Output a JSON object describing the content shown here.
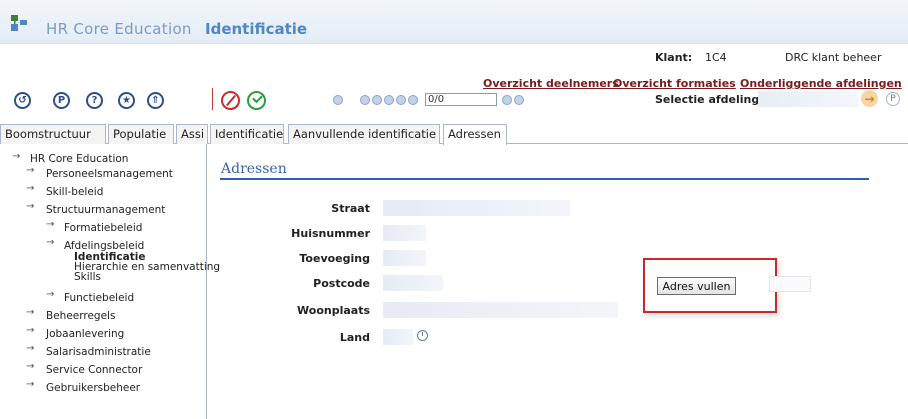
{
  "header": {
    "app_name": "HR Core Education",
    "page_name": "Identificatie"
  },
  "account": {
    "klant_label": "Klant:",
    "klant_value": "1C4",
    "role": "DRC klant beheer"
  },
  "links": {
    "overzicht_deelnemers": "Overzicht deelnemers",
    "overzicht_formaties": "Overzicht formaties",
    "onderliggende_afdelingen": "Onderliggende afdelingen"
  },
  "toolbar": {
    "icons": [
      "back-icon",
      "pin-icon",
      "help-icon",
      "favorite-icon",
      "upload-icon",
      "cancel-icon",
      "confirm-icon"
    ],
    "record_counter": "0/0"
  },
  "selectie": {
    "label": "Selectie afdeling",
    "value": "",
    "help": "P"
  },
  "tabs_left": [
    "Boomstructuur",
    "Populatie",
    "Assi"
  ],
  "tabs_main": [
    "Identificatie",
    "Aanvullende identificatie",
    "Adressen"
  ],
  "active_tab": "Adressen",
  "tree": {
    "root": "HR Core Education",
    "items": [
      "Personeelsmanagement",
      "Skill-beleid",
      "Structuurmanagement",
      "Formatiebeleid",
      "Afdelingsbeleid",
      "Identificatie",
      "Hierarchie en samenvatting",
      "Skills",
      "Functiebeleid",
      "Beheerregels",
      "Jobaanlevering",
      "Salarisadministratie",
      "Service Connector",
      "Gebruikersbeheer"
    ]
  },
  "section": {
    "title": "Adressen"
  },
  "form": {
    "fields": [
      {
        "label": "Straat",
        "value": ""
      },
      {
        "label": "Huisnummer",
        "value": ""
      },
      {
        "label": "Toevoeging",
        "value": ""
      },
      {
        "label": "Postcode",
        "value": ""
      },
      {
        "label": "Woonplaats",
        "value": ""
      },
      {
        "label": "Land",
        "value": ""
      }
    ],
    "adres_vullen_label": "Adres vullen"
  },
  "colors": {
    "section_accent": "#2f5fa8",
    "highlight_border": "#c62b2b",
    "link_color": "#7a1b1b"
  }
}
